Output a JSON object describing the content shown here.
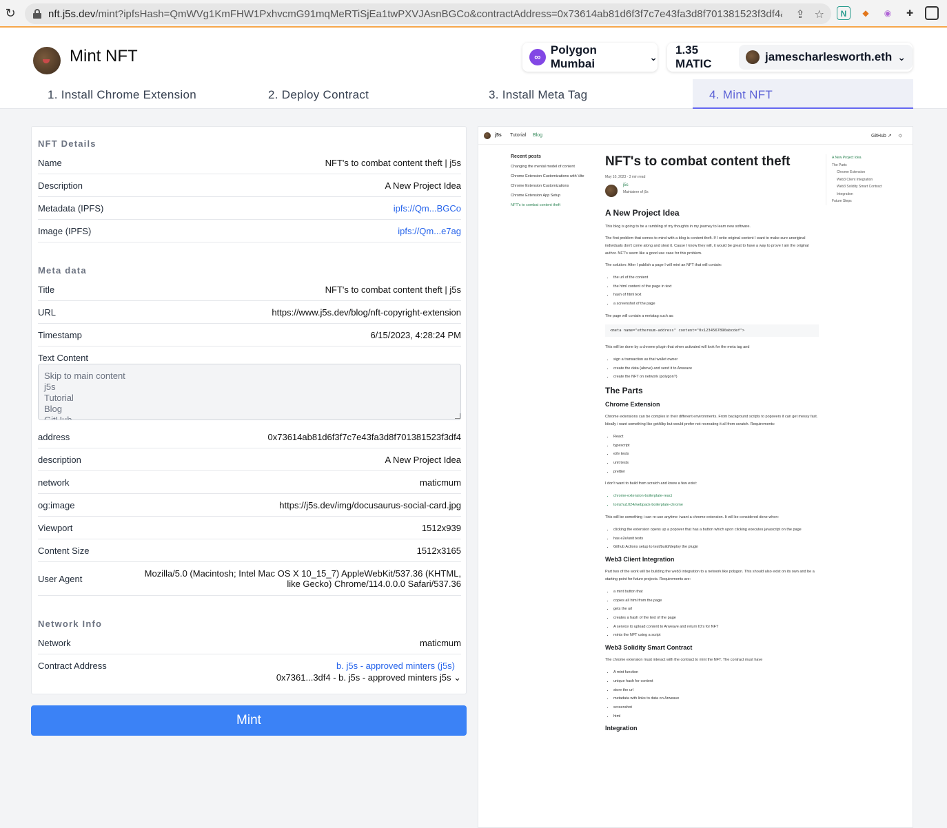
{
  "browser": {
    "host": "nft.j5s.dev",
    "path": "/mint?ipfsHash=QmWVg1KmFHW1PxhvcmG91mqMeRTiSjEa1twPXVJAsnBGCo&contractAddress=0x73614ab81d6f3f7c7e43fa3d8f701381523f3df4&..."
  },
  "header": {
    "title": "Mint NFT",
    "network": "Polygon Mumbai",
    "balance": "1.35 MATIC",
    "account": "jamescharlesworth.eth"
  },
  "tabs": [
    {
      "label": "1. Install Chrome Extension"
    },
    {
      "label": "2. Deploy Contract"
    },
    {
      "label": "3. Install Meta Tag"
    },
    {
      "label": "4. Mint NFT"
    }
  ],
  "nft_details": {
    "title": "NFT Details",
    "rows": [
      {
        "key": "Name",
        "value": "NFT's to combat content theft | j5s"
      },
      {
        "key": "Description",
        "value": "A New Project Idea"
      },
      {
        "key": "Metadata (IPFS)",
        "value": "ipfs://Qm...BGCo"
      },
      {
        "key": "Image (IPFS)",
        "value": "ipfs://Qm...e7ag"
      }
    ]
  },
  "meta_data": {
    "title": "Meta data",
    "rows": [
      {
        "key": "Title",
        "value": "NFT's to combat content theft | j5s"
      },
      {
        "key": "URL",
        "value": "https://www.j5s.dev/blog/nft-copyright-extension"
      },
      {
        "key": "Timestamp",
        "value": "6/15/2023, 4:28:24 PM"
      },
      {
        "key": "Text Content",
        "value": ""
      }
    ],
    "text_content": "Skip to main content\nj5s\nTutorial\nBlog\nGitHub",
    "rows2": [
      {
        "key": "address",
        "value": "0x73614ab81d6f3f7c7e43fa3d8f701381523f3df4"
      },
      {
        "key": "description",
        "value": "A New Project Idea"
      },
      {
        "key": "network",
        "value": "maticmum"
      },
      {
        "key": "og:image",
        "value": "https://j5s.dev/img/docusaurus-social-card.jpg"
      },
      {
        "key": "Viewport",
        "value": "1512x939"
      },
      {
        "key": "Content Size",
        "value": "1512x3165"
      },
      {
        "key": "User Agent",
        "value_line1": "Mozilla/5.0 (Macintosh; Intel Mac OS X 10_15_7) AppleWebKit/537.36 (KHTML,",
        "value_line2": "like Gecko) Chrome/114.0.0.0 Safari/537.36"
      }
    ]
  },
  "network_info": {
    "title": "Network Info",
    "network_key": "Network",
    "network_value": "maticmum",
    "contract_key": "Contract Address",
    "contract_link": "b. j5s - approved minters (j5s)",
    "contract_select": "0x7361...3df4 - b. j5s - approved minters j5s"
  },
  "mint_button": "Mint",
  "preview": {
    "nav": {
      "brand": "j5s",
      "tutorial": "Tutorial",
      "blog": "Blog",
      "github": "GitHub"
    },
    "sidebar": {
      "heading": "Recent posts",
      "items": [
        "Changing the mental model of content",
        "Chrome Extension Customizations with Vite",
        "Chrome Extension Customizations",
        "Chrome Extension App Setup",
        "NFT's to combat content theft"
      ]
    },
    "post": {
      "title": "NFT's to combat content theft",
      "meta": "May 10, 2023 · 3 min read",
      "author": "j5s",
      "author_role": "Maintainer of j5s",
      "h_idea": "A New Project Idea",
      "p1": "This blog is going to be a rambling of my thoughts in my journey to learn new software.",
      "p2": "The first problem that comes to mind with a blog is content theft. If I write original content I want to make sure unoriginal individuals don't come along and steal it. Cause I know they will, it would be great to have a way to prove I am the original author. NFT's seem like a good use case for this problem.",
      "p3": "The solution: After I publish a page I will mint an NFT that will contain:",
      "list1": [
        "the url of the content",
        "the html content of the page in text",
        "hash of html text",
        "a screenshot of the page"
      ],
      "p4": "The page will contain a metatag such as:",
      "code": "<meta name=\"ethereum-address\" content=\"0x1234567890abcdef\">",
      "p5": "This will be done by a chrome plugin that when activated will look for the meta tag and",
      "list2": [
        "sign a transaction as that wallet owner",
        "create the data (above) and send it to Arweave",
        "create the NFT on network (polygon?)"
      ],
      "h_parts": "The Parts",
      "h_chrome": "Chrome Extension",
      "p6": "Chrome extensions can be complex in their different environments. From background scripts to popovers it can get messy fast. Ideally i want something like getAlby but would prefer not recreating it all from scratch. Requirements:",
      "list3": [
        "React",
        "typescript",
        "e2e tests",
        "unit tests",
        "prettier"
      ],
      "p7": "I don't want to build from scratch and know a few exist:",
      "list4": [
        "chrome-extension-boilerplate-react",
        "tomzhu1024/webpack-boilerplate-chrome"
      ],
      "p8": "This will be something i can re-use anytime i want a chrome extension. It will be considered done when:",
      "list5": [
        "clicking the extension opens up a popover that has a button which upon clicking executes javascript on the page",
        "has e2e/unit tests",
        "Github Actions setup to test/build/deploy the plugin"
      ],
      "h_web3": "Web3 Client Integration",
      "p9": "Part two of the work will be building the web3 integration to a network like polygon. This should also exist on its own and be a starting point for future projects. Requirements are:",
      "list6": [
        "a mint button that",
        "copies all html from the page",
        "gets the url",
        "creates a hash of the text of the page",
        "A service to upload content to Arweave and return ID's for NFT",
        "mints the NFT using a script"
      ],
      "h_sol": "Web3 Solidity Smart Contract",
      "p10": "The chrome extension must interact with the contract to mint the NFT. The contract must have",
      "list7": [
        "A mint function",
        "unique hash for content",
        "store the url",
        "metadata with links to data on Arweave",
        "screenshot",
        "html"
      ],
      "h_int": "Integration"
    },
    "toc": [
      "A New Project Idea",
      "The Parts",
      "Chrome Extension",
      "Web3 Client Integration",
      "Web3 Solidity Smart Contract",
      "Integration",
      "Future Steps"
    ]
  }
}
